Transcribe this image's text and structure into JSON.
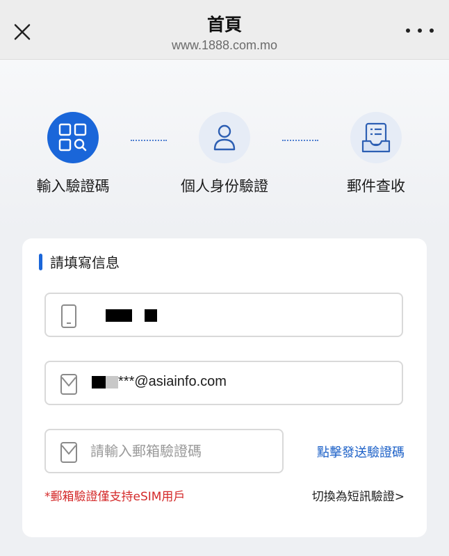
{
  "header": {
    "title": "首頁",
    "url": "www.1888.com.mo"
  },
  "steps": [
    {
      "label": "輸入驗證碼",
      "state": "active",
      "icon": "grid-search-icon"
    },
    {
      "label": "個人身份驗證",
      "state": "idle",
      "icon": "person-icon"
    },
    {
      "label": "郵件查收",
      "state": "idle",
      "icon": "mailbox-icon"
    }
  ],
  "form": {
    "section_title": "請填寫信息",
    "phone_value": "",
    "email_suffix": "***@asiainfo.com",
    "code_placeholder": "請輸入郵箱驗證碼",
    "send_code_label": "點擊發送驗證碼",
    "note": "*郵箱驗證僅支持eSIM用戶",
    "switch_label": "切換為短訊驗證>"
  },
  "colors": {
    "accent": "#1a66d9",
    "note_red": "#d42a2a",
    "link_blue": "#1a5fc7"
  }
}
